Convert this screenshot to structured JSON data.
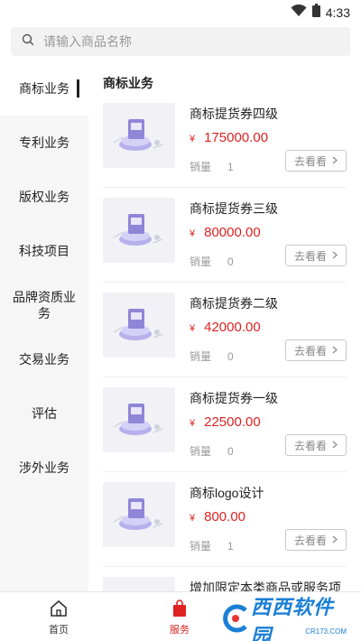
{
  "status": {
    "time": "4:33"
  },
  "search": {
    "placeholder": "请输入商品名称"
  },
  "sidebar": {
    "items": [
      {
        "label": "商标业务",
        "active": true
      },
      {
        "label": "专利业务"
      },
      {
        "label": "版权业务"
      },
      {
        "label": "科技项目"
      },
      {
        "label": "品牌资质业务"
      },
      {
        "label": "交易业务"
      },
      {
        "label": "评估"
      },
      {
        "label": "涉外业务"
      }
    ]
  },
  "content": {
    "section_title": "商标业务",
    "currency": "¥",
    "sales_label": "销量",
    "view_button": "去看看",
    "products": [
      {
        "name": "商标提货券四级",
        "price": "175000.00",
        "sales": "1"
      },
      {
        "name": "商标提货券三级",
        "price": "80000.00",
        "sales": "0"
      },
      {
        "name": "商标提货券二级",
        "price": "42000.00",
        "sales": "0"
      },
      {
        "name": "商标提货券一级",
        "price": "22500.00",
        "sales": "0"
      },
      {
        "name": "商标logo设计",
        "price": "800.00",
        "sales": "1"
      },
      {
        "name": "增加限定本类商品或服务项",
        "price": "",
        "sales": ""
      }
    ]
  },
  "tabbar": {
    "tabs": [
      {
        "label": "首页"
      },
      {
        "label": "服务",
        "active": true
      }
    ]
  },
  "watermark": {
    "text": "西西软件园",
    "small": "CR173.COM"
  },
  "colors": {
    "price": "#dd2222",
    "accent_red": "#dd2222",
    "sidebar_bg": "#f6f6f6"
  }
}
